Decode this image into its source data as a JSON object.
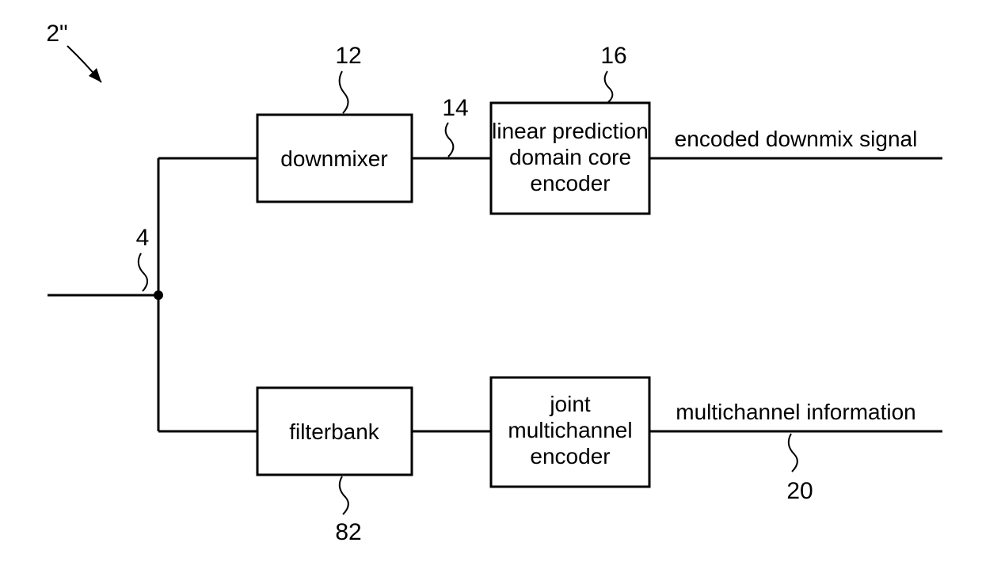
{
  "diagram": {
    "system_ref": "2\"",
    "input_ref": "4",
    "blocks": {
      "downmixer": {
        "label": "downmixer",
        "ref": "12"
      },
      "mid_signal_ref": "14",
      "lp_encoder": {
        "line1": "linear prediction",
        "line2": "domain core",
        "line3": "encoder",
        "ref": "16"
      },
      "filterbank": {
        "label": "filterbank",
        "ref": "82"
      },
      "mc_encoder": {
        "line1": "joint",
        "line2": "multichannel",
        "line3": "encoder"
      }
    },
    "outputs": {
      "top": "encoded downmix signal",
      "bottom": "multichannel information",
      "bottom_ref": "20"
    }
  }
}
